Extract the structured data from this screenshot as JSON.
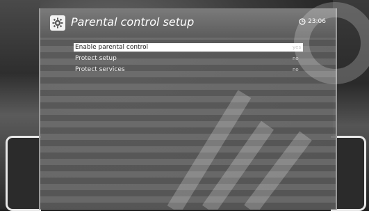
{
  "header": {
    "title": "Parental control setup",
    "clock": "23:06"
  },
  "menu": {
    "items": [
      {
        "label": "Enable parental control",
        "value": "yes",
        "selected": true
      },
      {
        "label": "Protect setup",
        "value": "no",
        "selected": false
      },
      {
        "label": "Protect services",
        "value": "no",
        "selected": false
      }
    ]
  },
  "colors": {
    "panel": "#6e6e6e",
    "highlight": "#ffffff",
    "text": "#f2f2f2"
  },
  "icons": {
    "header_icon": "gear-icon",
    "clock_icon": "clock-icon"
  }
}
